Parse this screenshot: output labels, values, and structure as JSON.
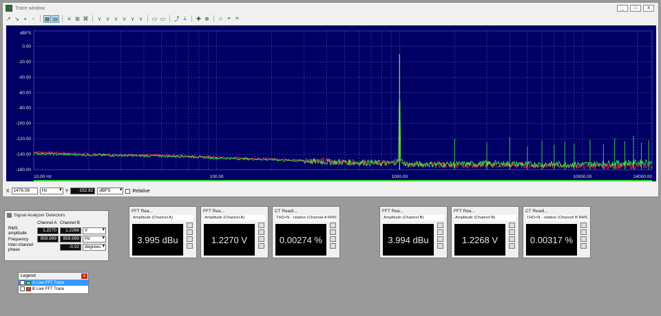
{
  "window": {
    "title": "Trace window",
    "btn_min": "_",
    "btn_max": "□",
    "btn_close": "x"
  },
  "toolbar": {
    "icons": [
      "zoom-in-icon",
      "zoom-out-icon",
      "save-icon",
      "print-icon",
      "grid-icon",
      "chart-icon",
      "options-icon",
      "cursor-icon",
      "peak-icon",
      "marker-icon",
      "marker-icon",
      "marker-icon",
      "marker-icon",
      "marker-icon",
      "marker-icon",
      "marker-icon",
      "measure-icon",
      "measure-icon",
      "select-icon",
      "fit-icon",
      "fit-icon",
      "fit-icon",
      "settings-icon",
      "cursor-icon",
      "cursor-icon"
    ]
  },
  "chart_data": {
    "type": "line",
    "ylabel": "dBFS",
    "xscale": "log",
    "xlim": [
      10,
      24000
    ],
    "ylim": [
      -160,
      20
    ],
    "yticks": [
      "0.00",
      "-20.00",
      "-40.00",
      "-60.00",
      "-80.00",
      "-100.00",
      "-120.00",
      "-140.00",
      "-160.00"
    ],
    "yvals": [
      0,
      -20,
      -40,
      -60,
      -80,
      -100,
      -120,
      -140,
      -160
    ],
    "xticks": [
      "10.00 Hz",
      "100.00",
      "1000.00",
      "10000.00",
      "24000.00"
    ],
    "xvals": [
      10,
      100,
      1000,
      10000,
      24000
    ],
    "series": [
      {
        "color": "#ff3030",
        "x": [
          10,
          20,
          40,
          70,
          100,
          200,
          400,
          700,
          900,
          990,
          1000,
          1010,
          1100,
          2000,
          3000,
          5000,
          10000,
          24000
        ],
        "y": [
          -137,
          -140,
          -141,
          -142,
          -144,
          -146,
          -149,
          -151,
          -152,
          -148,
          -12,
          -148,
          -153,
          -154,
          -154,
          -154,
          -155,
          -155
        ]
      },
      {
        "color": "#40ff40",
        "x": [
          10,
          20,
          40,
          70,
          100,
          200,
          400,
          700,
          900,
          990,
          1000,
          1010,
          1100,
          2000,
          3000,
          5000,
          10000,
          24000
        ],
        "y": [
          -139,
          -141,
          -142,
          -143,
          -145,
          -147,
          -150,
          -151,
          -152,
          -148,
          -10,
          -148,
          -153,
          -153,
          -152,
          -153,
          -153,
          -150
        ]
      }
    ],
    "harmonics_x": [
      2000,
      3000,
      4000,
      5000,
      6000,
      7000,
      8000,
      9000,
      11000,
      13000,
      15000,
      17000,
      19000,
      21000,
      23000
    ],
    "harmonics_y": [
      -120,
      -125,
      -118,
      -130,
      -122,
      -128,
      -124,
      -126,
      -121,
      -127,
      -119,
      -123,
      -116,
      -125,
      -122
    ]
  },
  "status": {
    "x_label": "X",
    "x_value": "1476.56",
    "x_unit": "Hz",
    "y_label": "Y",
    "y_value": "-152.82",
    "y_unit": "dBFS",
    "relative": "Relative"
  },
  "detectors": {
    "title": "Signal Analyzer Detectors",
    "col_a": "Channel A",
    "col_b": "Channel B",
    "rows": [
      {
        "label": "RMS amplitude",
        "a": "1.2270",
        "b": "1.2268",
        "unit": "V"
      },
      {
        "label": "Frequency",
        "a": "959.999",
        "b": "959.999",
        "unit": "Hz"
      },
      {
        "label": "Inter-channel phase",
        "a": "",
        "b": "-0.02",
        "unit": "degrees"
      }
    ]
  },
  "readouts": [
    {
      "title": "FFT Rea...",
      "caption": "Amplitude (Channel A)",
      "value": "3.995 dBu",
      "color": "#dcc4c4"
    },
    {
      "title": "FFT Rea...",
      "caption": "Amplitude (Channel A)",
      "value": "1.2270 V",
      "color": "#dcc4c4"
    },
    {
      "title": "CT Readi...",
      "caption": "THD+N - relative (Channel A RMS)",
      "value": "0.00274 %",
      "color": "#c4dcc4"
    },
    {
      "title": "FFT Rea...",
      "caption": "Amplitude (Channel B)",
      "value": "3.994 dBu",
      "color": "#dcc4c4"
    },
    {
      "title": "FFT Rea...",
      "caption": "Amplitude (Channel B)",
      "value": "1.2268 V",
      "color": "#dcc4c4"
    },
    {
      "title": "CT Readi...",
      "caption": "THD+N - relative (Channel B RMS)",
      "value": "0.00317 %",
      "color": "#c4dcc4"
    }
  ],
  "legend": {
    "title": "Legend",
    "close": "x",
    "items": [
      {
        "channel": "A",
        "label": "Live FFT Trace",
        "color": "#40ff40"
      },
      {
        "channel": "B",
        "label": "Live FFT Trace",
        "color": "#ff3030"
      }
    ]
  }
}
